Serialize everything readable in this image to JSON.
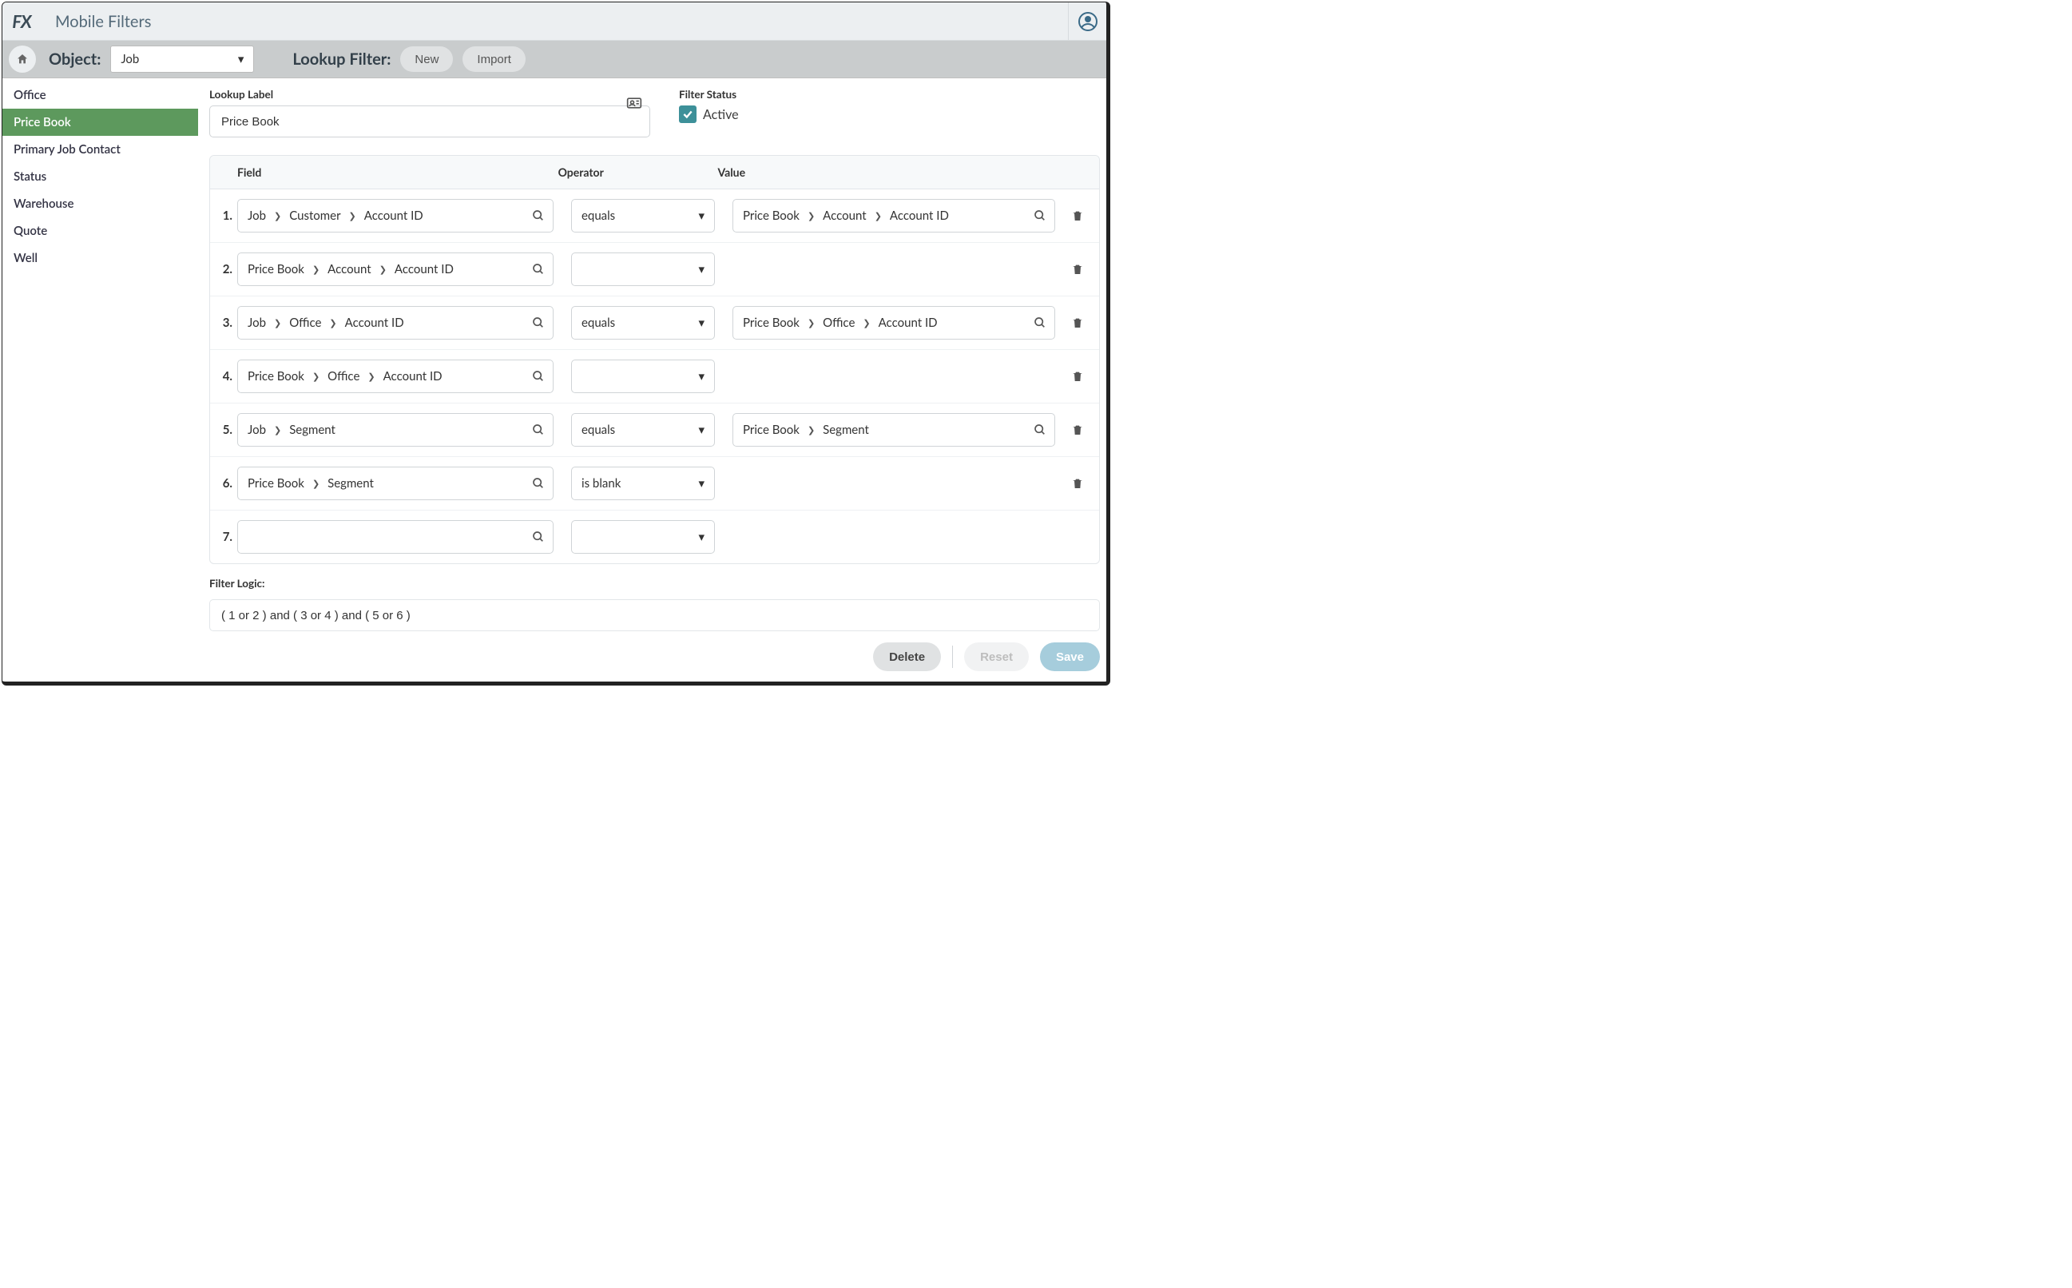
{
  "header": {
    "title": "Mobile Filters",
    "logo": "FX"
  },
  "subbar": {
    "object_label": "Object:",
    "object_value": "Job",
    "lookup_label": "Lookup Filter:",
    "new_btn": "New",
    "import_btn": "Import"
  },
  "sidebar": {
    "items": [
      {
        "label": "Office",
        "active": false
      },
      {
        "label": "Price Book",
        "active": true
      },
      {
        "label": "Primary Job Contact",
        "active": false
      },
      {
        "label": "Status",
        "active": false
      },
      {
        "label": "Warehouse",
        "active": false
      },
      {
        "label": "Quote",
        "active": false
      },
      {
        "label": "Well",
        "active": false
      }
    ]
  },
  "main": {
    "lookup_label_heading": "Lookup Label",
    "lookup_label_value": "Price Book",
    "filter_status_heading": "Filter Status",
    "filter_status_value": "Active",
    "columns": {
      "field": "Field",
      "operator": "Operator",
      "value": "Value"
    },
    "rows": [
      {
        "n": "1.",
        "field": [
          "Job",
          "Customer",
          "Account ID"
        ],
        "operator": "equals",
        "value": [
          "Price Book",
          "Account",
          "Account ID"
        ],
        "has_value": true,
        "has_delete": true
      },
      {
        "n": "2.",
        "field": [
          "Price Book",
          "Account",
          "Account ID"
        ],
        "operator": "",
        "value": [],
        "has_value": false,
        "has_delete": true
      },
      {
        "n": "3.",
        "field": [
          "Job",
          "Office",
          "Account ID"
        ],
        "operator": "equals",
        "value": [
          "Price Book",
          "Office",
          "Account ID"
        ],
        "has_value": true,
        "has_delete": true
      },
      {
        "n": "4.",
        "field": [
          "Price Book",
          "Office",
          "Account ID"
        ],
        "operator": "",
        "value": [],
        "has_value": false,
        "has_delete": true
      },
      {
        "n": "5.",
        "field": [
          "Job",
          "Segment"
        ],
        "operator": "equals",
        "value": [
          "Price Book",
          "Segment"
        ],
        "has_value": true,
        "has_delete": true
      },
      {
        "n": "6.",
        "field": [
          "Price Book",
          "Segment"
        ],
        "operator": "is blank",
        "value": [],
        "has_value": false,
        "has_delete": true
      },
      {
        "n": "7.",
        "field": [],
        "operator": "",
        "value": [],
        "has_value": false,
        "has_delete": false
      }
    ],
    "filter_logic_label": "Filter Logic:",
    "filter_logic_value": "( 1 or 2 ) and ( 3 or 4 ) and ( 5 or 6 )",
    "buttons": {
      "delete": "Delete",
      "reset": "Reset",
      "save": "Save"
    }
  }
}
